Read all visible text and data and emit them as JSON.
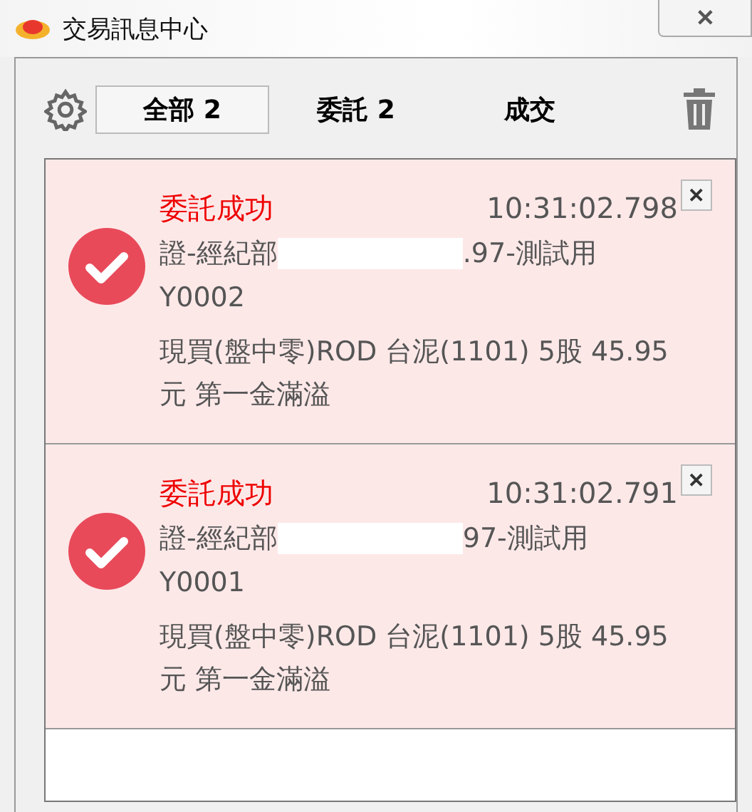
{
  "window": {
    "title": "交易訊息中心",
    "close": "✕"
  },
  "tabs": [
    {
      "label": "全部 2",
      "selected": true
    },
    {
      "label": "委託 2",
      "selected": false
    },
    {
      "label": "成交",
      "selected": false
    }
  ],
  "messages": [
    {
      "title": "委託成功",
      "time": "10:31:02.798",
      "close": "✕",
      "account_prefix": "證-經紀部",
      "redacted": true,
      "account_suffix": ".97-測試用",
      "account_id": "Y0002",
      "detail": "現買(盤中零)ROD 台泥(1101) 5股 45.95元 第一金滿溢"
    },
    {
      "title": "委託成功",
      "time": "10:31:02.791",
      "close": "✕",
      "account_prefix": "證-經紀部",
      "redacted": true,
      "account_suffix": "97-測試用",
      "account_id": "Y0001",
      "detail": "現買(盤中零)ROD 台泥(1101) 5股 45.95元 第一金滿溢"
    }
  ]
}
